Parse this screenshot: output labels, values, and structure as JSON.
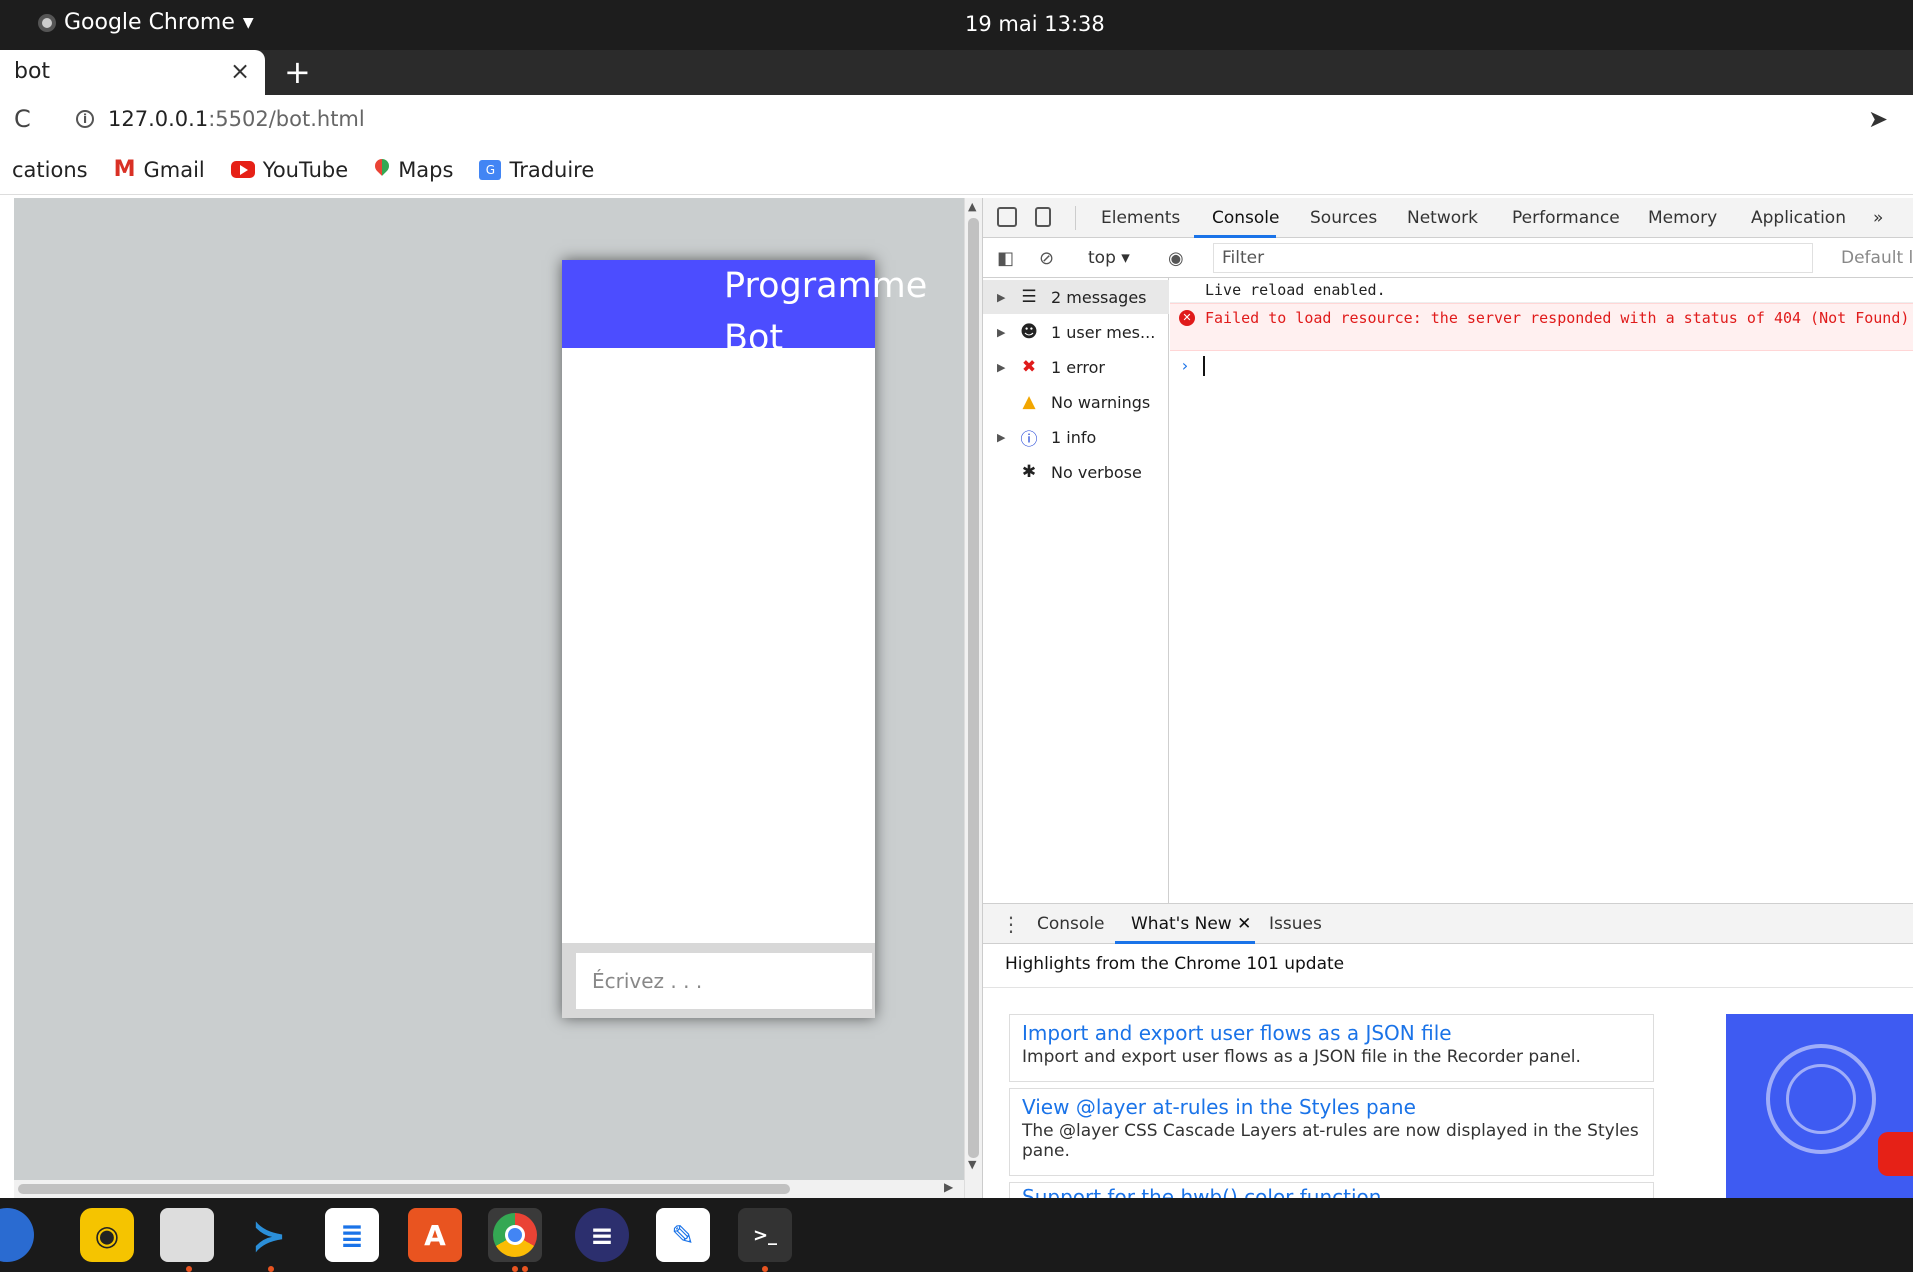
{
  "topbar": {
    "app_name": "Google Chrome",
    "clock": "19 mai  13:38"
  },
  "tab": {
    "title": "bot",
    "close": "×",
    "new_tab": "+"
  },
  "address": {
    "host": "127.0.0.1",
    "path": ":5502/bot.html"
  },
  "bookmarks": [
    {
      "label": "cations"
    },
    {
      "label": "Gmail"
    },
    {
      "label": "YouTube"
    },
    {
      "label": "Maps"
    },
    {
      "label": "Traduire"
    }
  ],
  "bot": {
    "header_title": "Programme Bot",
    "input_placeholder": "Écrivez . . ."
  },
  "devtools": {
    "tabs": [
      "Elements",
      "Console",
      "Sources",
      "Network",
      "Performance",
      "Memory",
      "Application",
      "»"
    ],
    "active_tab": "Console",
    "context": "top ▾",
    "filter_placeholder": "Filter",
    "levels": "Default le",
    "sidebar": [
      {
        "label": "2 messages",
        "icon": "list-icon"
      },
      {
        "label": "1 user mes...",
        "icon": "user-icon"
      },
      {
        "label": "1 error",
        "icon": "error-icon"
      },
      {
        "label": "No warnings",
        "icon": "warning-icon"
      },
      {
        "label": "1 info",
        "icon": "info-icon"
      },
      {
        "label": "No verbose",
        "icon": "bug-icon"
      }
    ],
    "messages": {
      "info": "Live reload enabled.",
      "error": "Failed to load resource: the server responded with a status of 404 (Not Found)"
    },
    "drawer": {
      "tabs": [
        "Console",
        "What's New",
        "Issues"
      ],
      "active": "What's New",
      "highlight_title": "Highlights from the Chrome 101 update",
      "cards": [
        {
          "title": "Import and export user flows as a JSON file",
          "desc": "Import and export user flows as a JSON file in the Recorder panel."
        },
        {
          "title": "View @layer at-rules in the Styles pane",
          "desc": "The @layer CSS Cascade Layers at-rules are now displayed in the Styles pane."
        },
        {
          "title": "Support for the hwb() color function",
          "desc": ""
        }
      ]
    }
  },
  "colors": {
    "bot_header": "#4c4dff",
    "page_bg": "#cacecf",
    "error_red": "#e01b1b",
    "link_blue": "#1a73e8"
  }
}
